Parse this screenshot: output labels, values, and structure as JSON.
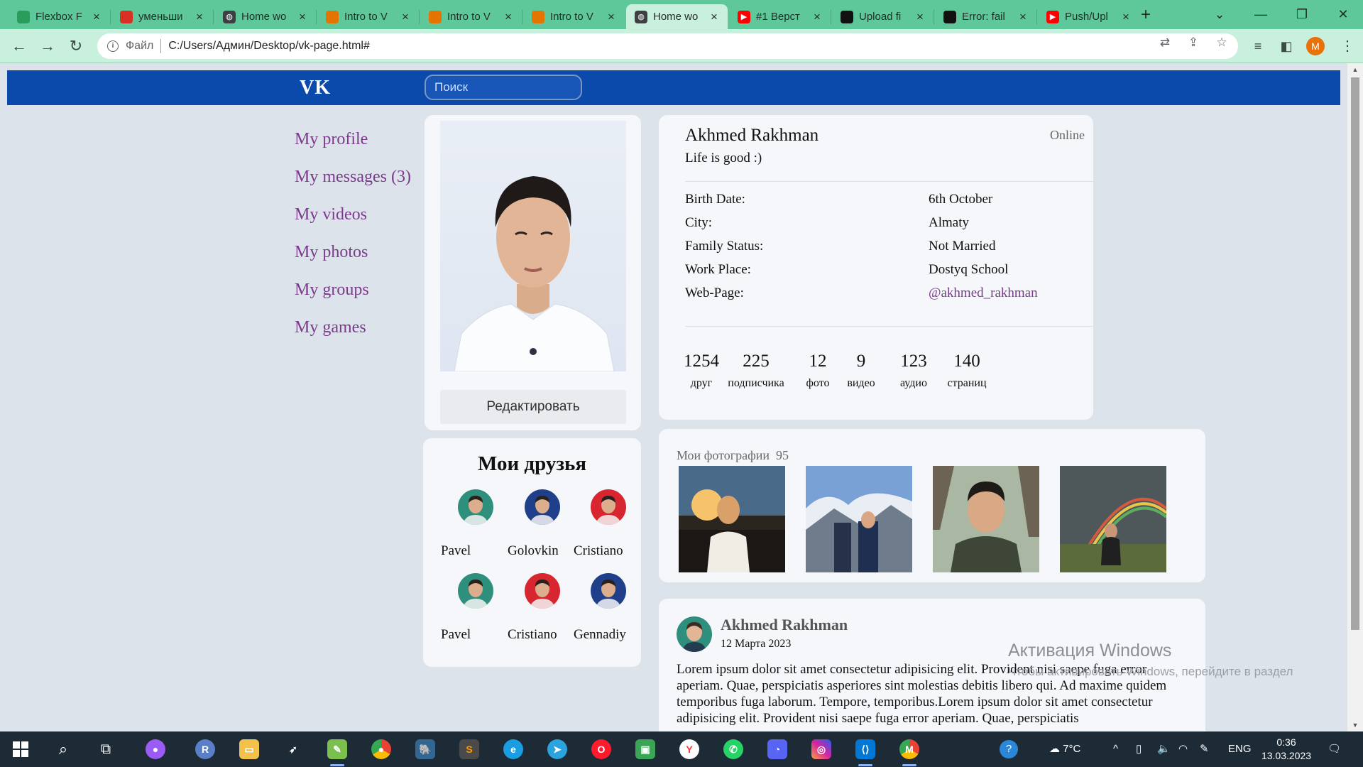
{
  "browser": {
    "tabs": [
      {
        "title": "Flexbox F",
        "icon": "codepen-green-icon",
        "color": "#2a9d5c"
      },
      {
        "title": "уменьши",
        "icon": "translate-icon",
        "color": "#d93025"
      },
      {
        "title": "Home wo",
        "icon": "globe-icon",
        "color": "#3c4043"
      },
      {
        "title": "Intro to V",
        "icon": "bolt-icon",
        "color": "#e37400"
      },
      {
        "title": "Intro to V",
        "icon": "bolt-icon",
        "color": "#e37400"
      },
      {
        "title": "Intro to V",
        "icon": "bolt-icon",
        "color": "#e37400"
      },
      {
        "title": "Home wo",
        "icon": "globe-icon",
        "color": "#3c4043",
        "active": true
      },
      {
        "title": "#1 Верст",
        "icon": "youtube-icon",
        "color": "#ff0000"
      },
      {
        "title": "Upload fi",
        "icon": "github-icon",
        "color": "#111111"
      },
      {
        "title": "Error: fail",
        "icon": "arc-icon",
        "color": "#111111"
      },
      {
        "title": "Push/Upl",
        "icon": "youtube-icon",
        "color": "#ff0000"
      }
    ],
    "address": {
      "scheme_label": "Файл",
      "url": "C:/Users/Админ/Desktop/vk-page.html#"
    },
    "profile_initial": "M"
  },
  "vk": {
    "logo": "VK",
    "search_placeholder": "Поиск",
    "nav": [
      "My profile",
      "My messages (3)",
      "My videos",
      "My photos",
      "My groups",
      "My games"
    ],
    "edit_button": "Редактировать",
    "profile": {
      "name": "Akhmed Rakhman",
      "online": "Online",
      "status": "Life is good :)",
      "fields": [
        {
          "key": "Birth Date:",
          "value": "6th October",
          "link": false
        },
        {
          "key": "City:",
          "value": "Almaty",
          "link": false
        },
        {
          "key": "Family Status:",
          "value": "Not Married",
          "link": false
        },
        {
          "key": "Work Place:",
          "value": "Dostyq School",
          "link": false
        },
        {
          "key": "Web-Page:",
          "value": "@akhmed_rakhman",
          "link": true
        }
      ],
      "stats": [
        {
          "num": "1254",
          "label": "друг"
        },
        {
          "num": "225",
          "label": "подписчика"
        },
        {
          "num": "12",
          "label": "фото"
        },
        {
          "num": "9",
          "label": "видео"
        },
        {
          "num": "123",
          "label": "аудио"
        },
        {
          "num": "140",
          "label": "страниц"
        }
      ]
    },
    "friends": {
      "title": "Мои друзья",
      "list": [
        {
          "name": "Pavel",
          "tone": "#2f8f7d"
        },
        {
          "name": "Golovkin",
          "tone": "#1f3f8a"
        },
        {
          "name": "Cristiano",
          "tone": "#d7262f"
        },
        {
          "name": "Pavel",
          "tone": "#2f8f7d"
        },
        {
          "name": "Cristiano",
          "tone": "#d7262f"
        },
        {
          "name": "Gennadiy",
          "tone": "#1f3f8a"
        }
      ]
    },
    "photos": {
      "title": "Мои фотографии",
      "count": "95"
    },
    "post": {
      "author": "Akhmed Rakhman",
      "date": "12 Марта 2023",
      "text": "Lorem ipsum dolor sit amet consectetur adipisicing elit. Provident nisi saepe fuga error aperiam. Quae, perspiciatis asperiores sint molestias debitis libero qui. Ad maxime quidem temporibus fuga laborum. Tempore, temporibus.Lorem ipsum dolor sit amet consectetur adipisicing elit. Provident nisi saepe fuga error aperiam. Quae, perspiciatis"
    }
  },
  "watermark": {
    "title": "Активация Windows",
    "subtitle": "Чтобы активировать Windows, перейдите в раздел"
  },
  "taskbar": {
    "weather": "7°C",
    "lang": "ENG",
    "time": "0:36",
    "date": "13.03.2023"
  },
  "colors": {
    "vk_blue": "#0b4aab",
    "link_purple": "#7a3b8c",
    "chrome_green": "#5fc89a"
  }
}
